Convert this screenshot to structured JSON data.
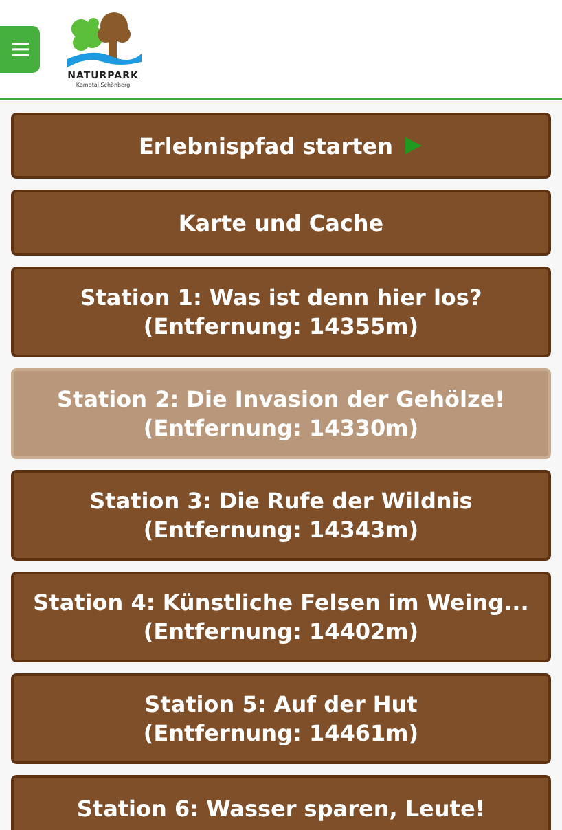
{
  "header": {
    "logo": {
      "title": "NATURPARK",
      "subtitle": "Kamptal Schönberg"
    }
  },
  "buttons": [
    {
      "kind": "start",
      "lines": [
        "Erlebnispfad starten"
      ],
      "disabled": false
    },
    {
      "kind": "plain",
      "lines": [
        "Karte und Cache"
      ],
      "disabled": false
    },
    {
      "kind": "plain",
      "lines": [
        "Station 1: Was ist denn hier los?",
        "(Entfernung: 14355m)"
      ],
      "disabled": false
    },
    {
      "kind": "plain",
      "lines": [
        "Station 2: Die Invasion der Gehölze!",
        "(Entfernung: 14330m)"
      ],
      "disabled": true
    },
    {
      "kind": "plain",
      "lines": [
        "Station 3: Die Rufe der Wildnis",
        "(Entfernung: 14343m)"
      ],
      "disabled": false
    },
    {
      "kind": "plain",
      "lines": [
        "Station 4: Künstliche Felsen im Weing...",
        "(Entfernung: 14402m)"
      ],
      "disabled": false
    },
    {
      "kind": "plain",
      "lines": [
        "Station 5: Auf der Hut",
        "(Entfernung: 14461m)"
      ],
      "disabled": false
    },
    {
      "kind": "plain",
      "lines": [
        "Station 6: Wasser sparen, Leute!"
      ],
      "disabled": false
    }
  ]
}
